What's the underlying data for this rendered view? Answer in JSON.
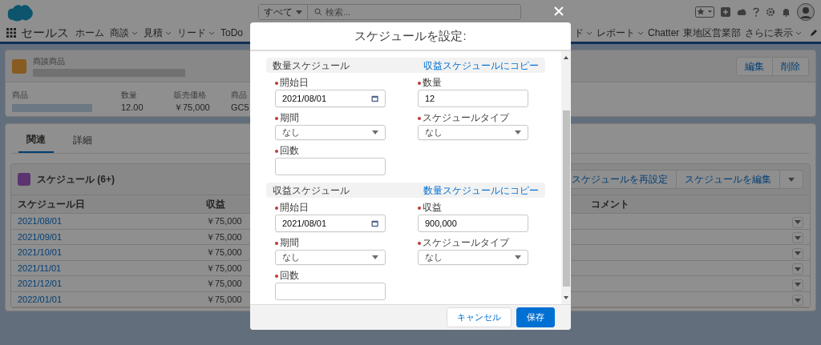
{
  "header": {
    "search_scope": "すべて",
    "search_placeholder": "検索..."
  },
  "nav": {
    "app_name": "セールス",
    "items": [
      {
        "label": "ホーム",
        "menu": false
      },
      {
        "label": "商談",
        "menu": true
      },
      {
        "label": "見積",
        "menu": true
      },
      {
        "label": "リード",
        "menu": true
      },
      {
        "label": "ToDo",
        "menu": false
      }
    ],
    "items_right": [
      {
        "label": "ド",
        "menu": true
      },
      {
        "label": "レポート",
        "menu": true
      },
      {
        "label": "Chatter",
        "menu": false
      },
      {
        "label": "東地区営業部",
        "menu": false
      },
      {
        "label": "さらに表示",
        "menu": true
      }
    ]
  },
  "record": {
    "object_label": "商談商品",
    "buttons": [
      "編集",
      "削除"
    ],
    "fields": [
      {
        "label": "商品",
        "kind": "redacted"
      },
      {
        "label": "数量",
        "kind": "text",
        "value": "12.00"
      },
      {
        "label": "販売価格",
        "kind": "text",
        "value": "￥75,000"
      },
      {
        "label": "商品",
        "kind": "text",
        "value": "GC5"
      }
    ]
  },
  "tabs": [
    {
      "label": "関連",
      "selected": true
    },
    {
      "label": "詳細",
      "selected": false
    }
  ],
  "related_list": {
    "title": "スケジュール (6+)",
    "buttons": [
      "スケジュールを再設定",
      "スケジュールを編集"
    ],
    "columns": [
      "スケジュール日",
      "収益",
      "コメント"
    ],
    "rows": [
      {
        "date": "2021/08/01",
        "revenue": "￥75,000"
      },
      {
        "date": "2021/09/01",
        "revenue": "￥75,000"
      },
      {
        "date": "2021/10/01",
        "revenue": "￥75,000"
      },
      {
        "date": "2021/11/01",
        "revenue": "￥75,000"
      },
      {
        "date": "2021/12/01",
        "revenue": "￥75,000"
      },
      {
        "date": "2022/01/01",
        "revenue": "￥75,000"
      }
    ]
  },
  "modal": {
    "title": "スケジュールを設定:",
    "sections": [
      {
        "title": "数量スケジュール",
        "copy_link": "収益スケジュールにコピー",
        "fields": [
          {
            "label": "開始日",
            "required": true,
            "kind": "date",
            "value": "2021/08/01"
          },
          {
            "label": "数量",
            "required": true,
            "kind": "text",
            "value": "12"
          },
          {
            "label": "期間",
            "required": true,
            "kind": "select",
            "value": "なし"
          },
          {
            "label": "スケジュールタイプ",
            "required": true,
            "kind": "select",
            "value": "なし"
          },
          {
            "label": "回数",
            "required": true,
            "kind": "text"
          }
        ]
      },
      {
        "title": "収益スケジュール",
        "copy_link": "数量スケジュールにコピー",
        "fields": [
          {
            "label": "開始日",
            "required": true,
            "kind": "date",
            "value": "2021/08/01"
          },
          {
            "label": "収益",
            "required": true,
            "kind": "text",
            "value": "900,000"
          },
          {
            "label": "期間",
            "required": true,
            "kind": "select",
            "value": "なし"
          },
          {
            "label": "スケジュールタイプ",
            "required": true,
            "kind": "select",
            "value": "なし"
          },
          {
            "label": "回数",
            "required": true,
            "kind": "text"
          }
        ]
      }
    ],
    "buttons": [
      {
        "label": "キャンセル",
        "kind": "neutral"
      },
      {
        "label": "保存",
        "kind": "brand"
      }
    ]
  }
}
